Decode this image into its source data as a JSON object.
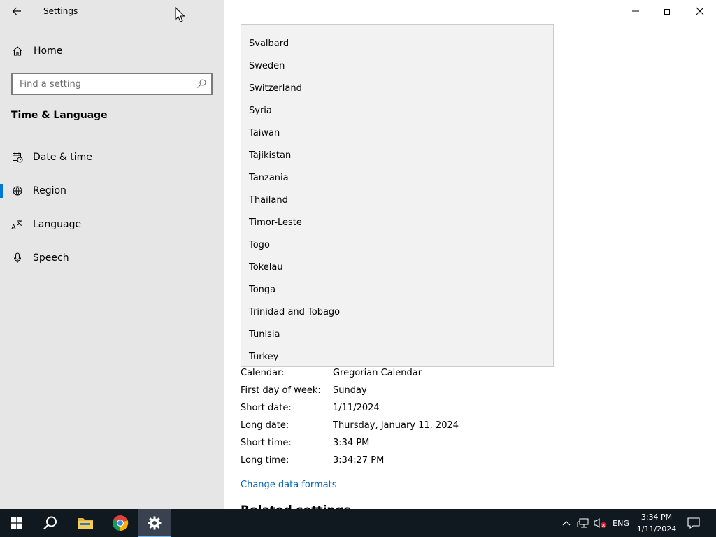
{
  "window": {
    "title": "Settings"
  },
  "sidebar": {
    "home_label": "Home",
    "search_placeholder": "Find a setting",
    "section_title": "Time & Language",
    "items": [
      {
        "label": "Date & time"
      },
      {
        "label": "Region"
      },
      {
        "label": "Language"
      },
      {
        "label": "Speech"
      }
    ]
  },
  "dropdown": {
    "options": [
      "Svalbard",
      "Sweden",
      "Switzerland",
      "Syria",
      "Taiwan",
      "Tajikistan",
      "Tanzania",
      "Thailand",
      "Timor-Leste",
      "Togo",
      "Tokelau",
      "Tonga",
      "Trinidad and Tobago",
      "Tunisia",
      "Turkey"
    ]
  },
  "formats": {
    "rows": [
      {
        "label": "Calendar:",
        "value": "Gregorian Calendar"
      },
      {
        "label": "First day of week:",
        "value": "Sunday"
      },
      {
        "label": "Short date:",
        "value": "1/11/2024"
      },
      {
        "label": "Long date:",
        "value": "Thursday, January 11, 2024"
      },
      {
        "label": "Short time:",
        "value": "3:34 PM"
      },
      {
        "label": "Long time:",
        "value": "3:34:27 PM"
      }
    ],
    "change_link": "Change data formats",
    "related_heading": "Related settings"
  },
  "taskbar": {
    "language": "ENG",
    "time": "3:34 PM",
    "date": "1/11/2024"
  },
  "colors": {
    "accent": "#0078d7",
    "link": "#0067b8",
    "taskbar": "#101820"
  }
}
